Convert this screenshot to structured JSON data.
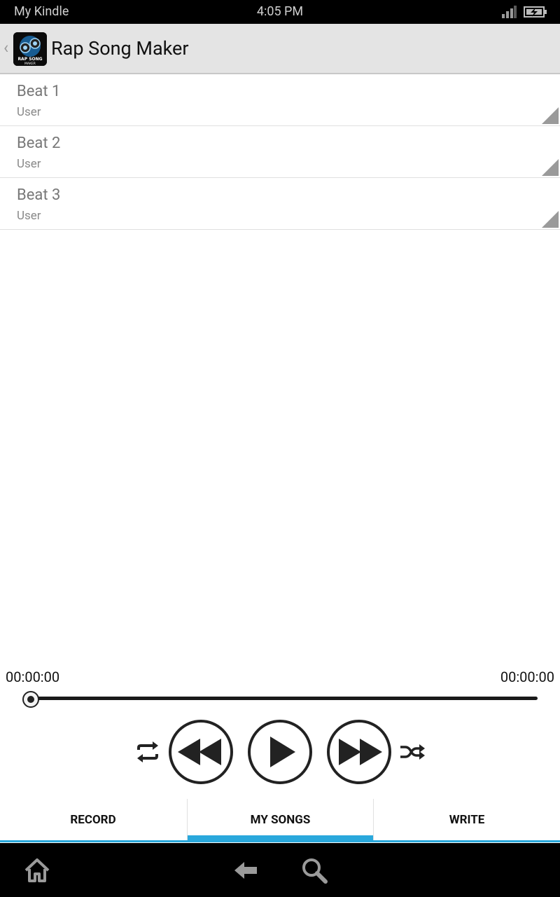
{
  "status_bar": {
    "carrier": "My Kindle",
    "time": "4:05 PM"
  },
  "app": {
    "title": "Rap Song Maker",
    "icon_text_1": "RAP SONG",
    "icon_text_2": "MAKER"
  },
  "songs": [
    {
      "title": "Beat 1",
      "artist": "User"
    },
    {
      "title": "Beat 2",
      "artist": "User"
    },
    {
      "title": "Beat 3",
      "artist": "User"
    }
  ],
  "player": {
    "elapsed": "00:00:00",
    "duration": "00:00:00",
    "progress": 0
  },
  "tabs": [
    {
      "label": "RECORD",
      "active": false
    },
    {
      "label": "MY SONGS",
      "active": true
    },
    {
      "label": "WRITE",
      "active": false
    }
  ],
  "colors": {
    "accent": "#29a8dc",
    "action_bar": "#e4e4e4",
    "status_bar": "#000000"
  }
}
